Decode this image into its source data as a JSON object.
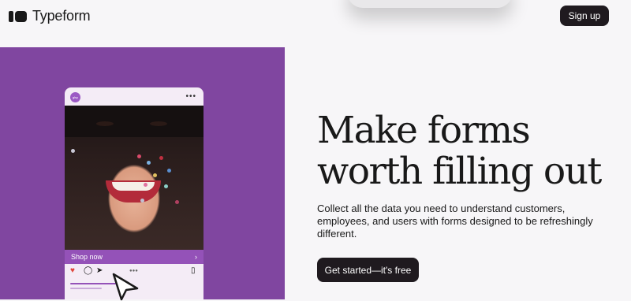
{
  "header": {
    "brand": "Typeform",
    "signup_label": "Sign up"
  },
  "hero": {
    "headline_line1": "Make forms",
    "headline_line2": "worth filling out",
    "subtext": "Collect all the data you need to understand customers, employees, and users with forms designed to be refreshingly different.",
    "cta_label": "Get started—it's free"
  },
  "phone_mockup": {
    "brand_badge": "glsy",
    "more_icon": "more-dots-icon",
    "shop_label": "Shop now",
    "shop_arrow": "›",
    "action_icons": [
      "heart-icon",
      "comment-icon",
      "share-icon",
      "bookmark-icon"
    ]
  },
  "colors": {
    "panel": "#8046a0",
    "accent_purple": "#9452b8",
    "button_dark": "#1f1a1f",
    "page_bg": "#f7f6f8"
  }
}
